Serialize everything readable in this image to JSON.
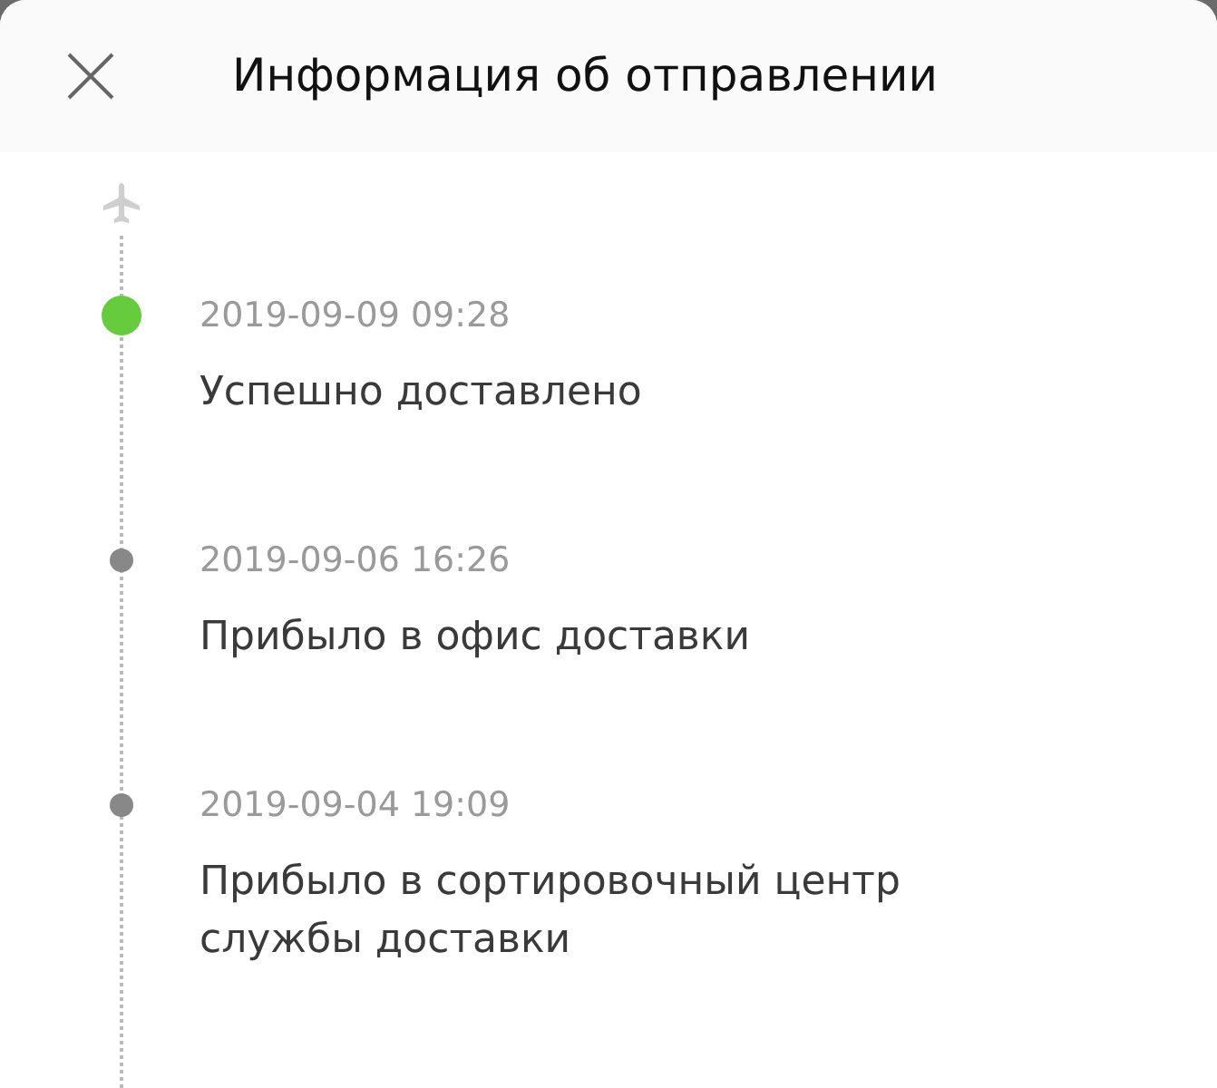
{
  "header": {
    "title": "Информация об отправлении"
  },
  "timeline": [
    {
      "date": "2019-09-09 09:28",
      "description": "Успешно доставлено",
      "current": true
    },
    {
      "date": "2019-09-06 16:26",
      "description": "Прибыло в офис доставки",
      "current": false
    },
    {
      "date": "2019-09-04 19:09",
      "description": "Прибыло в сортировочный центр службы доставки",
      "current": false
    }
  ]
}
